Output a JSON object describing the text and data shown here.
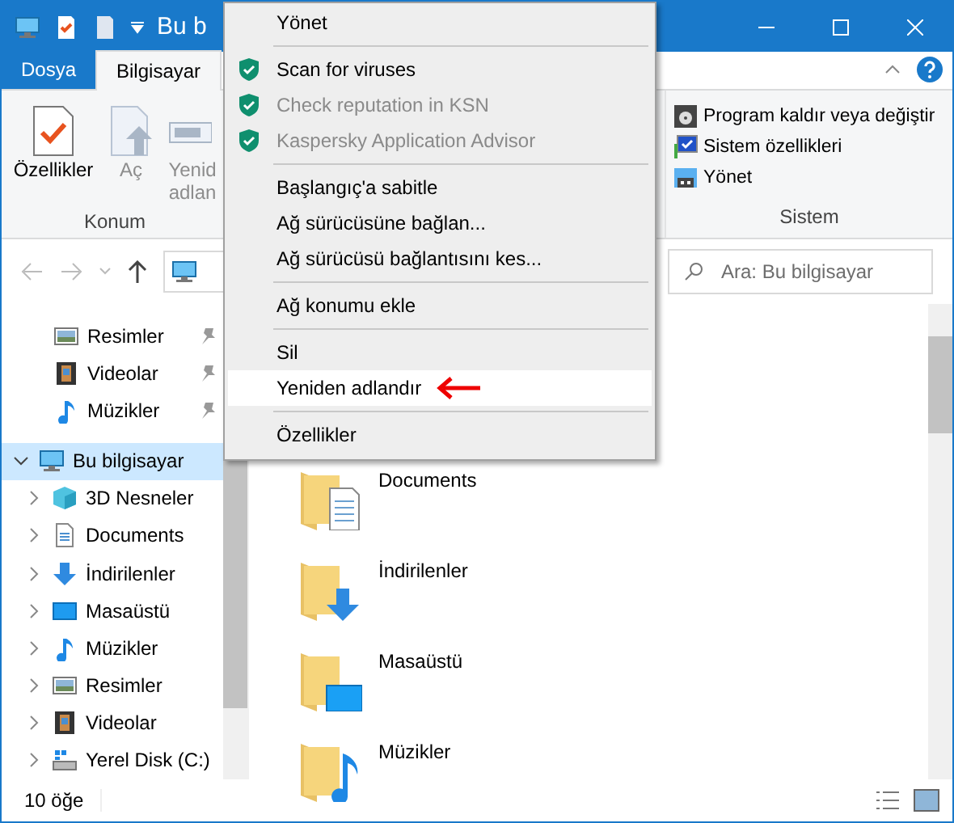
{
  "window": {
    "title": "Bu b"
  },
  "ribbon_tabs": [
    {
      "label": "Dosya",
      "kind": "file",
      "selected": false
    },
    {
      "label": "Bilgisayar",
      "kind": "tab",
      "selected": true
    }
  ],
  "ribbon": {
    "location": {
      "label": "Konum",
      "buttons": [
        {
          "label": "Özellikler",
          "kind": "properties",
          "disabled": false
        },
        {
          "label": "Aç",
          "kind": "open",
          "disabled": true
        },
        {
          "label": "Yenid adlan",
          "kind": "rename",
          "disabled": true
        }
      ]
    },
    "system": {
      "label": "Sistem",
      "buttons": [
        {
          "label": "Program kaldır veya değiştir",
          "kind": "uninstall"
        },
        {
          "label": "Sistem özellikleri",
          "kind": "system"
        },
        {
          "label": "Yönet",
          "kind": "manage"
        }
      ]
    }
  },
  "search": {
    "placeholder": "Ara: Bu bilgisayar"
  },
  "sidebar": {
    "quick_access": [
      {
        "label": "Resimler",
        "kind": "pictures",
        "pinned": true
      },
      {
        "label": "Videolar",
        "kind": "videos",
        "pinned": true
      },
      {
        "label": "Müzikler",
        "kind": "music",
        "pinned": true
      }
    ],
    "this_pc": {
      "label": "Bu bilgisayar",
      "selected": true,
      "expanded": true,
      "children": [
        {
          "label": "3D Nesneler",
          "kind": "objects",
          "expanded": false
        },
        {
          "label": "Documents",
          "kind": "documents",
          "expanded": false
        },
        {
          "label": "İndirilenler",
          "kind": "downloads",
          "expanded": false
        },
        {
          "label": "Masaüstü",
          "kind": "desktop",
          "expanded": false
        },
        {
          "label": "Müzikler",
          "kind": "music",
          "expanded": false
        },
        {
          "label": "Resimler",
          "kind": "pictures",
          "expanded": false
        },
        {
          "label": "Videolar",
          "kind": "videos",
          "expanded": false
        },
        {
          "label": "Yerel Disk (C:)",
          "kind": "disk",
          "expanded": false
        }
      ]
    }
  },
  "content": {
    "items": [
      {
        "label": "Documents",
        "kind": "documents"
      },
      {
        "label": "İndirilenler",
        "kind": "downloads"
      },
      {
        "label": "Masaüstü",
        "kind": "desktop"
      },
      {
        "label": "Müzikler",
        "kind": "music"
      }
    ]
  },
  "status_bar": {
    "count": "10 öğe"
  },
  "context_menu": {
    "items": [
      {
        "kind": "plain",
        "label": "Yönet",
        "disabled": false,
        "selected": false
      },
      {
        "kind": "separator"
      },
      {
        "kind": "shield",
        "label": "Scan for viruses",
        "disabled": false,
        "selected": false
      },
      {
        "kind": "shield",
        "label": "Check reputation in KSN",
        "disabled": true,
        "selected": false
      },
      {
        "kind": "shield",
        "label": "Kaspersky Application Advisor",
        "disabled": true,
        "selected": false
      },
      {
        "kind": "separator"
      },
      {
        "kind": "plain",
        "label": "Başlangıç'a sabitle",
        "disabled": false,
        "selected": false
      },
      {
        "kind": "plain",
        "label": "Ağ sürücüsüne bağlan...",
        "disabled": false,
        "selected": false
      },
      {
        "kind": "plain",
        "label": "Ağ sürücüsü bağlantısını kes...",
        "disabled": false,
        "selected": false
      },
      {
        "kind": "separator"
      },
      {
        "kind": "plain",
        "label": "Ağ konumu ekle",
        "disabled": false,
        "selected": false
      },
      {
        "kind": "separator"
      },
      {
        "kind": "plain",
        "label": "Sil",
        "disabled": false,
        "selected": false
      },
      {
        "kind": "plain",
        "label": "Yeniden adlandır",
        "disabled": false,
        "selected": true,
        "pointer": true
      },
      {
        "kind": "separator"
      },
      {
        "kind": "plain",
        "label": "Özellikler",
        "disabled": false,
        "selected": false
      }
    ]
  }
}
